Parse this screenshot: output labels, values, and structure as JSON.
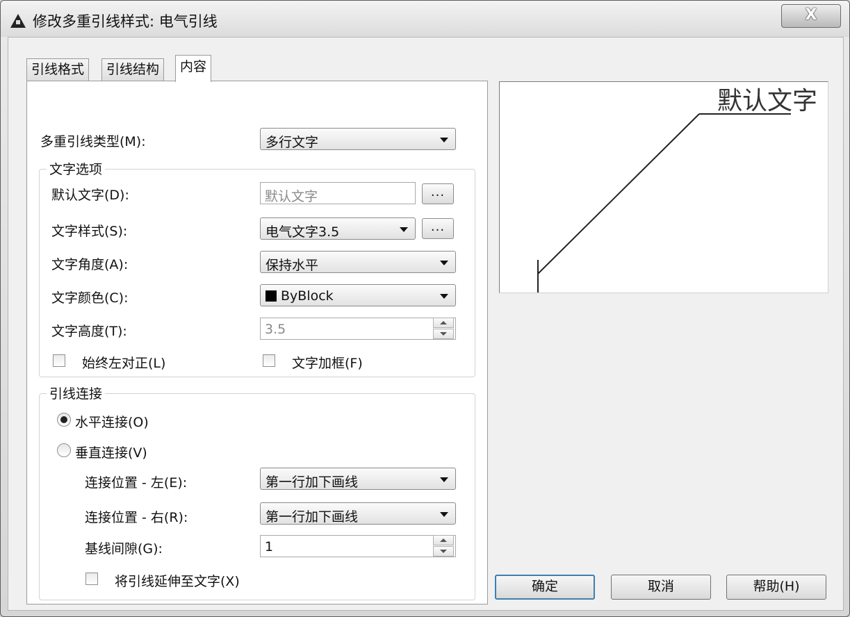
{
  "window": {
    "title": "修改多重引线样式: 电气引线",
    "close_label": "X"
  },
  "tabs": [
    {
      "label": "引线格式",
      "active": false
    },
    {
      "label": "引线结构",
      "active": false
    },
    {
      "label": "内容",
      "active": true
    }
  ],
  "content": {
    "leader_type": {
      "label": "多重引线类型(M):",
      "value": "多行文字"
    },
    "text_options": {
      "title": "文字选项",
      "default_text": {
        "label": "默认文字(D):",
        "value": "默认文字",
        "browse_label": "..."
      },
      "text_style": {
        "label": "文字样式(S):",
        "value": "电气文字3.5",
        "browse_label": "..."
      },
      "text_angle": {
        "label": "文字角度(A):",
        "value": "保持水平"
      },
      "text_color": {
        "label": "文字颜色(C):",
        "value": "ByBlock",
        "swatch_color": "#000000"
      },
      "text_height": {
        "label": "文字高度(T):",
        "value": "3.5"
      },
      "always_left_justify": {
        "label": "始终左对正(L)",
        "checked": false
      },
      "text_frame": {
        "label": "文字加框(F)",
        "checked": false
      }
    },
    "leader_connection": {
      "title": "引线连接",
      "horizontal": {
        "label": "水平连接(O)",
        "selected": true
      },
      "vertical": {
        "label": "垂直连接(V)",
        "selected": false
      },
      "attach_left": {
        "label": "连接位置 - 左(E):",
        "value": "第一行加下画线"
      },
      "attach_right": {
        "label": "连接位置 - 右(R):",
        "value": "第一行加下画线"
      },
      "landing_gap": {
        "label": "基线间隙(G):",
        "value": "1"
      },
      "extend_to_text": {
        "label": "将引线延伸至文字(X)",
        "checked": false
      }
    }
  },
  "preview": {
    "sample_text": "默认文字"
  },
  "buttons": {
    "ok": "确定",
    "cancel": "取消",
    "help": "帮助(H)"
  },
  "colors": {
    "default_button_border": "#3c7fb1",
    "panel": "#ffffff",
    "dialog": "#f0f0f0"
  }
}
